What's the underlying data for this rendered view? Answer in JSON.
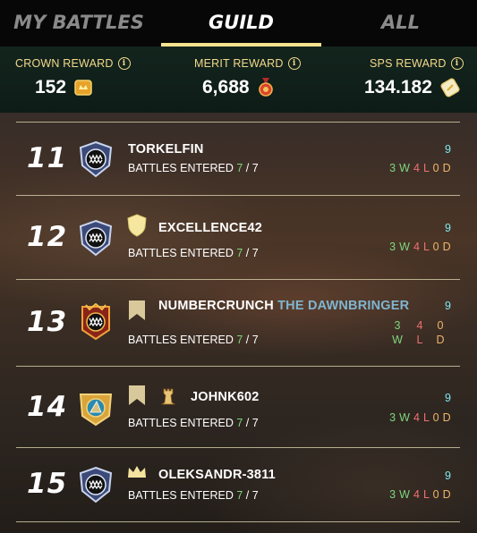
{
  "tabs": [
    {
      "label": "MY BATTLES",
      "active": false
    },
    {
      "label": "GUILD",
      "active": true
    },
    {
      "label": "ALL",
      "active": false
    }
  ],
  "rewards": {
    "crown": {
      "label": "CROWN REWARD",
      "value": "152",
      "icon": "crown-token-icon"
    },
    "merit": {
      "label": "MERIT REWARD",
      "value": "6,688",
      "icon": "merit-medal-icon"
    },
    "sps": {
      "label": "SPS REWARD",
      "value": "134.182",
      "icon": "sps-token-icon"
    }
  },
  "battles_label": "BATTLES ENTERED",
  "rows": [
    {
      "rank": "11",
      "name": "TORKELFIN",
      "title": "",
      "entered": "7",
      "total": "7",
      "score": "9",
      "wins": "3",
      "losses": "4",
      "draws": "0",
      "w": "W",
      "l": "L",
      "d": "D",
      "badges": []
    },
    {
      "rank": "12",
      "name": "EXCELLENCE42",
      "title": "",
      "entered": "7",
      "total": "7",
      "score": "9",
      "wins": "3",
      "losses": "4",
      "draws": "0",
      "w": "W",
      "l": "L",
      "d": "D",
      "badges": [
        "shield-badge-icon"
      ]
    },
    {
      "rank": "13",
      "name": "NUMBERCRUNCH",
      "title": "THE DAWNBRINGER",
      "entered": "7",
      "total": "7",
      "score": "9",
      "wins": "3",
      "losses": "4",
      "draws": "0",
      "w": "W",
      "l": "L",
      "d": "D",
      "badges": [
        "banner-badge-icon"
      ]
    },
    {
      "rank": "14",
      "name": "JOHNK602",
      "title": "",
      "entered": "7",
      "total": "7",
      "score": "9",
      "wins": "3",
      "losses": "4",
      "draws": "0",
      "w": "W",
      "l": "L",
      "d": "D",
      "badges": [
        "banner-badge-icon",
        "tower-badge-icon"
      ]
    },
    {
      "rank": "15",
      "name": "OLEKSANDR-3811",
      "title": "",
      "entered": "7",
      "total": "7",
      "score": "9",
      "wins": "3",
      "losses": "4",
      "draws": "0",
      "w": "W",
      "l": "L",
      "d": "D",
      "badges": [
        "crown-badge-icon"
      ]
    }
  ],
  "colors": {
    "accent": "#f6e38e",
    "wins": "#7ed67e",
    "losses": "#f07070",
    "draws": "#f0b46a",
    "score": "#7ee7ee"
  }
}
